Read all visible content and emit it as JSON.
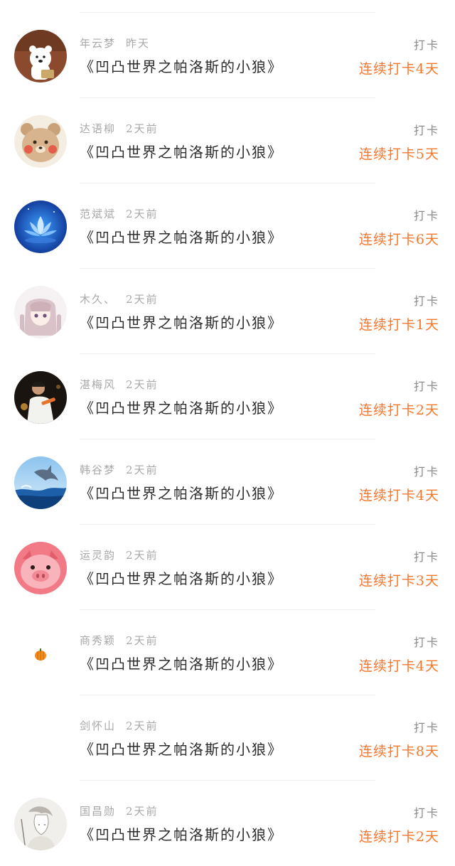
{
  "feed": {
    "items": [
      {
        "user": "年云梦",
        "time": "昨天",
        "book": "《凹凸世界之帕洛斯的小狼》",
        "action": "打卡",
        "streak": "连续打卡4天",
        "avatar_icon": "polar-bear-avatar"
      },
      {
        "user": "达语柳",
        "time": "2天前",
        "book": "《凹凸世界之帕洛斯的小狼》",
        "action": "打卡",
        "streak": "连续打卡5天",
        "avatar_icon": "bear-avatar"
      },
      {
        "user": "范斌斌",
        "time": "2天前",
        "book": "《凹凸世界之帕洛斯的小狼》",
        "action": "打卡",
        "streak": "连续打卡6天",
        "avatar_icon": "lotus-avatar"
      },
      {
        "user": "木久、",
        "time": "2天前",
        "book": "《凹凸世界之帕洛斯的小狼》",
        "action": "打卡",
        "streak": "连续打卡1天",
        "avatar_icon": "anime-girl-avatar"
      },
      {
        "user": "湛梅风",
        "time": "2天前",
        "book": "《凹凸世界之帕洛斯的小狼》",
        "action": "打卡",
        "streak": "连续打卡2天",
        "avatar_icon": "person-photo-avatar"
      },
      {
        "user": "韩谷梦",
        "time": "2天前",
        "book": "《凹凸世界之帕洛斯的小狼》",
        "action": "打卡",
        "streak": "连续打卡4天",
        "avatar_icon": "dolphin-avatar"
      },
      {
        "user": "运灵韵",
        "time": "2天前",
        "book": "《凹凸世界之帕洛斯的小狼》",
        "action": "打卡",
        "streak": "连续打卡3天",
        "avatar_icon": "pig-avatar"
      },
      {
        "user": "商秀颖",
        "time": "2天前",
        "book": "《凹凸世界之帕洛斯的小狼》",
        "action": "打卡",
        "streak": "连续打卡4天",
        "avatar_icon": "pumpkin-avatar"
      },
      {
        "user": "剑怀山",
        "time": "2天前",
        "book": "《凹凸世界之帕洛斯的小狼》",
        "action": "打卡",
        "streak": "连续打卡8天",
        "avatar_icon": "blank-avatar"
      },
      {
        "user": "国昌勋",
        "time": "2天前",
        "book": "《凹凸世界之帕洛斯的小狼》",
        "action": "打卡",
        "streak": "连续打卡2天",
        "avatar_icon": "sketch-avatar"
      }
    ]
  },
  "colors": {
    "streak": "#f4772e",
    "meta": "#a8a8a8",
    "book": "#2c2c2c"
  }
}
